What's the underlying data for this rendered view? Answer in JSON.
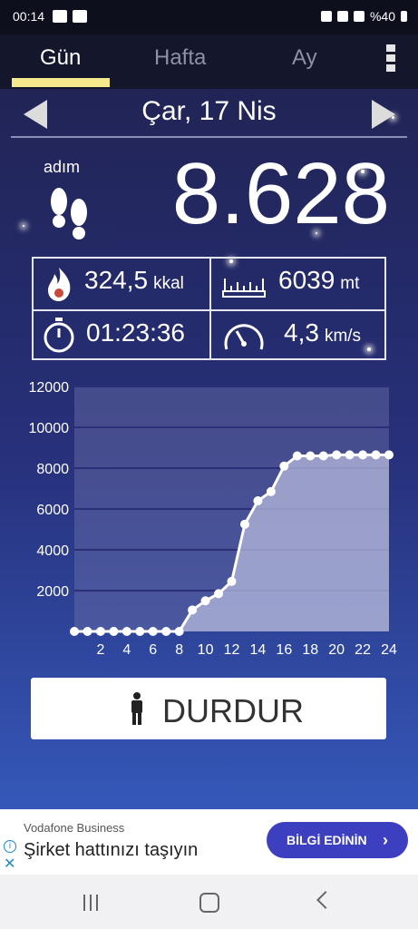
{
  "status_bar": {
    "time": "00:14",
    "battery": "%40"
  },
  "tabs": [
    {
      "label": "Gün",
      "active": true
    },
    {
      "label": "Hafta",
      "active": false
    },
    {
      "label": "Ay",
      "active": false
    }
  ],
  "date_nav": {
    "date": "Çar, 17 Nis"
  },
  "steps": {
    "label": "adım",
    "value": "8.628"
  },
  "stats": {
    "calories": {
      "value": "324,5",
      "unit": "kkal"
    },
    "distance": {
      "value": "6039",
      "unit": "mt"
    },
    "duration": {
      "value": "01:23:36"
    },
    "speed": {
      "value": "4,3",
      "unit": "km/s"
    }
  },
  "chart_data": {
    "type": "line",
    "title": "",
    "xlabel": "",
    "ylabel": "",
    "x_ticks": [
      "2",
      "4",
      "6",
      "8",
      "10",
      "12",
      "14",
      "16",
      "18",
      "20",
      "22",
      "24"
    ],
    "y_ticks": [
      "2000",
      "4000",
      "6000",
      "8000",
      "10000",
      "12000"
    ],
    "ylim": [
      0,
      12000
    ],
    "xlim": [
      0,
      24
    ],
    "grid": true,
    "series": [
      {
        "x": [
          0,
          1,
          2,
          3,
          4,
          5,
          6,
          7,
          8,
          9,
          10,
          11,
          12,
          13,
          14,
          15,
          16,
          17,
          18,
          19,
          20,
          21,
          22,
          23,
          24
        ],
        "values": [
          0,
          0,
          0,
          0,
          0,
          0,
          0,
          0,
          0,
          1050,
          1500,
          1850,
          2450,
          5250,
          6400,
          6850,
          8100,
          8600,
          8600,
          8600,
          8650,
          8650,
          8650,
          8650,
          8650
        ]
      }
    ]
  },
  "stop_button": {
    "label": "DURDUR"
  },
  "ad": {
    "brand": "Vodafone Business",
    "headline": "Şirket hattınızı taşıyın",
    "cta": "BİLGİ EDİNİN"
  },
  "colors": {
    "tab_indicator": "#f4e98d",
    "chart_fill": "#a0a4d0",
    "ad_button": "#3c3fbf"
  }
}
